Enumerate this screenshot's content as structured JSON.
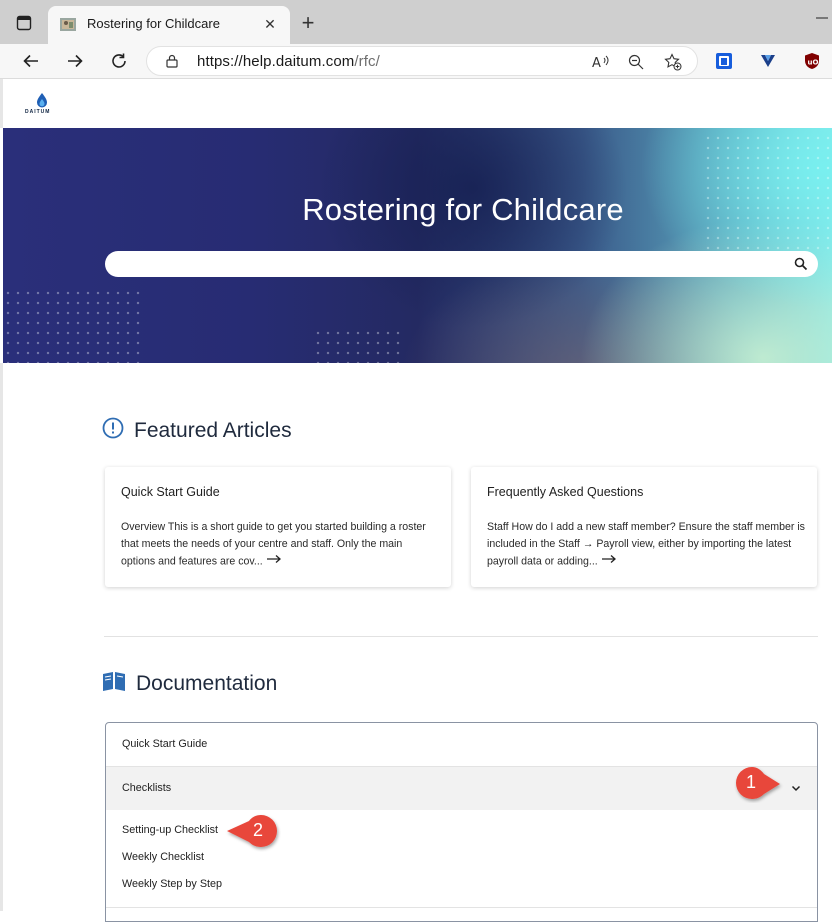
{
  "browser": {
    "tab_title": "Rostering for Childcare",
    "url_host": "https://help.daitum.com",
    "url_path": "/rfc/"
  },
  "site": {
    "logo_text": "DAITUM"
  },
  "hero": {
    "title": "Rostering for Childcare",
    "search_placeholder": ""
  },
  "featured": {
    "heading": "Featured Articles",
    "cards": [
      {
        "title": "Quick Start Guide",
        "excerpt": "Overview This is a short guide to get you started building a roster that meets the needs of your centre and staff. Only the main options and features are cov..."
      },
      {
        "title": "Frequently Asked Questions",
        "excerpt": "Staff How do I add a new staff member? Ensure the staff member is included in the Staff → Payroll view, either by importing the latest payroll data or adding..."
      }
    ]
  },
  "documentation": {
    "heading": "Documentation",
    "items": [
      {
        "label": "Quick Start Guide"
      },
      {
        "label": "Checklists",
        "expanded": true,
        "children": [
          "Setting-up Checklist",
          "Weekly Checklist",
          "Weekly Step by Step"
        ]
      }
    ]
  },
  "annotations": [
    "1",
    "2"
  ],
  "colors": {
    "callout_red": "#e8463a",
    "heading_icon_blue": "#2f6db3"
  }
}
